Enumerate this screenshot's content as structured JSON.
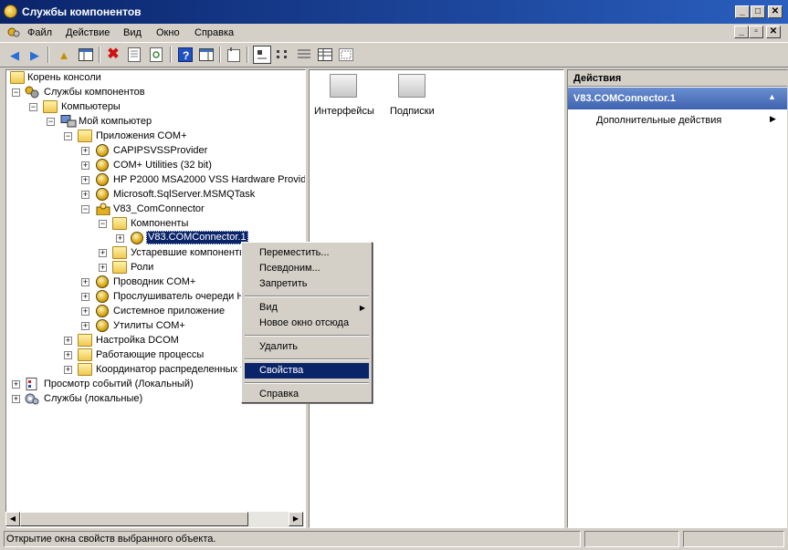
{
  "window": {
    "title": "Службы компонентов"
  },
  "menubar": {
    "items": [
      "Файл",
      "Действие",
      "Вид",
      "Окно",
      "Справка"
    ]
  },
  "tree": {
    "items": [
      {
        "label": "Корень консоли",
        "level": 0
      },
      {
        "label": "Службы компонентов",
        "level": 1
      },
      {
        "label": "Компьютеры",
        "level": 2
      },
      {
        "label": "Мой компьютер",
        "level": 3
      },
      {
        "label": "Приложения COM+",
        "level": 4
      },
      {
        "label": "CAPIPSVSSProvider",
        "level": 5
      },
      {
        "label": "COM+ Utilities (32 bit)",
        "level": 5
      },
      {
        "label": "HP P2000 MSA2000 VSS Hardware Provider",
        "level": 5
      },
      {
        "label": "Microsoft.SqlServer.MSMQTask",
        "level": 5
      },
      {
        "label": "V83_ComConnector",
        "level": 5
      },
      {
        "label": "Компоненты",
        "level": 6
      },
      {
        "label": "V83.COMConnector.1",
        "level": 7
      },
      {
        "label": "Устаревшие компоненты",
        "level": 6
      },
      {
        "label": "Роли",
        "level": 6
      },
      {
        "label": "Проводник COM+",
        "level": 5
      },
      {
        "label": "Прослушиватель очереди HTTP",
        "level": 5
      },
      {
        "label": "Системное приложение",
        "level": 5
      },
      {
        "label": "Утилиты COM+",
        "level": 5
      },
      {
        "label": "Настройка DCOM",
        "level": 4
      },
      {
        "label": "Работающие процессы",
        "level": 4
      },
      {
        "label": "Координатор распределенных транзакций",
        "level": 4
      },
      {
        "label": "Просмотр событий (Локальный)",
        "level": 1
      },
      {
        "label": "Службы (локальные)",
        "level": 1
      }
    ]
  },
  "content": {
    "items": [
      "Интерфейсы",
      "Подписки"
    ]
  },
  "actions": {
    "header": "Действия",
    "selected": "V83.COMConnector.1",
    "more": "Дополнительные действия"
  },
  "context_menu": {
    "items": [
      "Переместить...",
      "Псевдоним...",
      "Запретить",
      "Вид",
      "Новое окно отсюда",
      "Удалить",
      "Свойства",
      "Справка"
    ]
  },
  "status": {
    "text": "Открытие окна свойств выбранного объекта."
  },
  "colors": {
    "titlebar": "#0a246a",
    "selection": "#0a246a",
    "actions_header": "#4a6db5"
  }
}
